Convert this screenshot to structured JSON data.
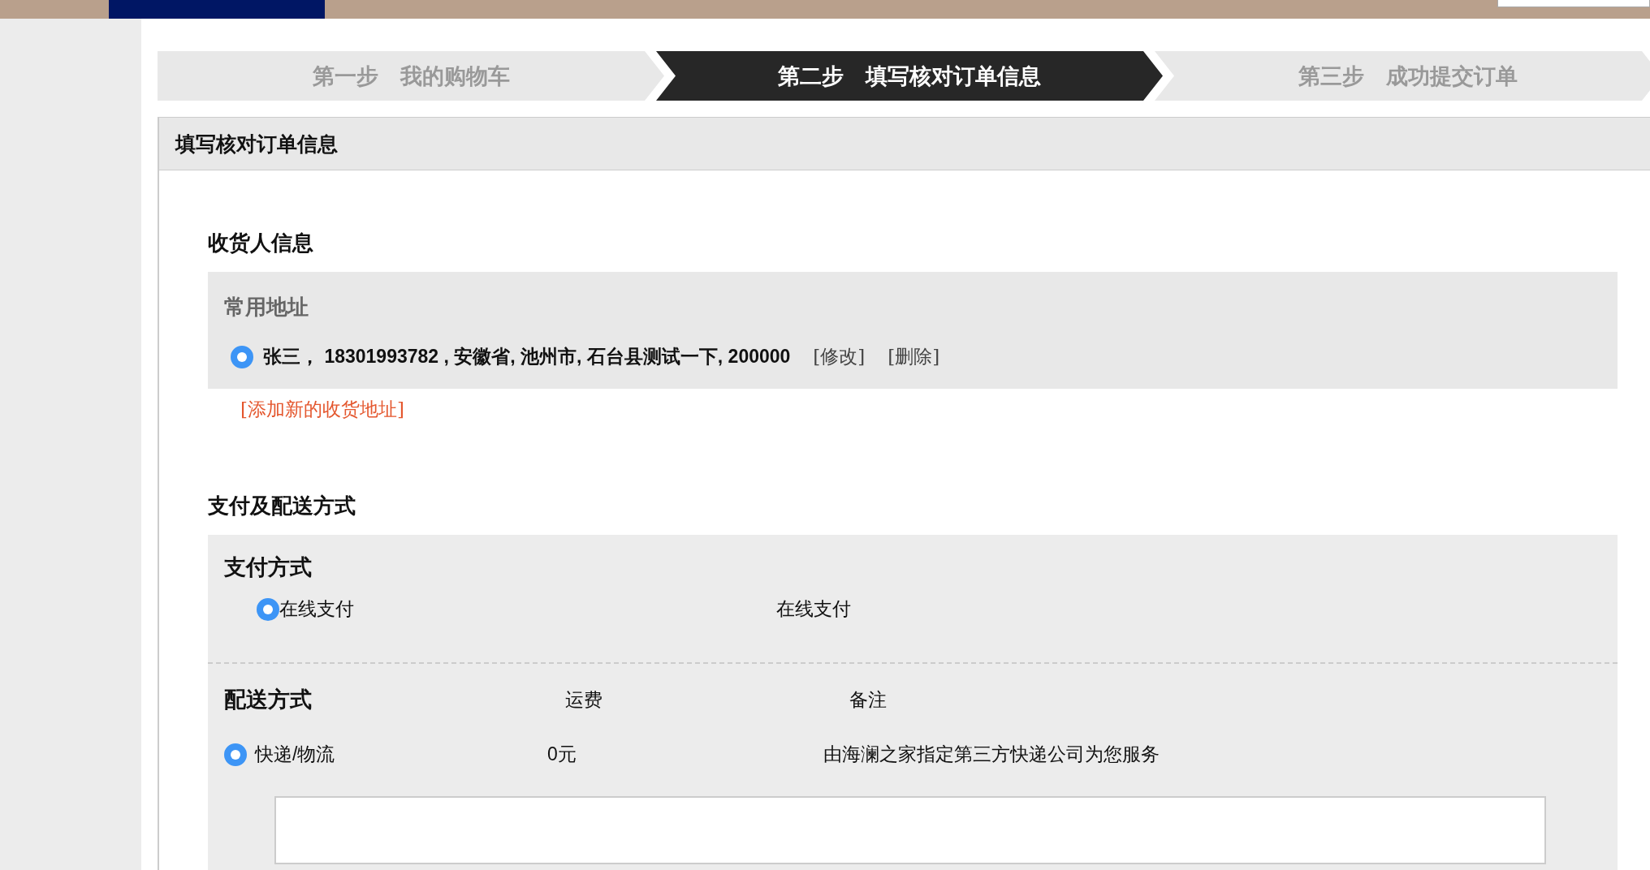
{
  "steps": [
    {
      "label": "第一步　我的购物车",
      "selected": false
    },
    {
      "label": "第二步　填写核对订单信息",
      "selected": true
    },
    {
      "label": "第三步　成功提交订单",
      "selected": false
    }
  ],
  "panel_title": "填写核对订单信息",
  "consignee": {
    "title": "收货人信息",
    "subtitle": "常用地址",
    "addresses": [
      {
        "text": "张三， 18301993782 , 安徽省, 池州市, 石台县测试一下, 200000",
        "selected": true,
        "edit": "[修改]",
        "delete": "[删除]"
      }
    ],
    "add_link": "[添加新的收货地址]"
  },
  "payment_delivery": {
    "title": "支付及配送方式",
    "payment": {
      "title": "支付方式",
      "options": [
        {
          "label": "在线支付",
          "note": "在线支付",
          "selected": true
        }
      ]
    },
    "delivery": {
      "title": "配送方式",
      "column_fee": "运费",
      "column_note": "备注",
      "options": [
        {
          "label": "快递/物流",
          "fee": "0元",
          "note": "由海澜之家指定第三方快递公司为您服务",
          "selected": true
        }
      ]
    }
  }
}
